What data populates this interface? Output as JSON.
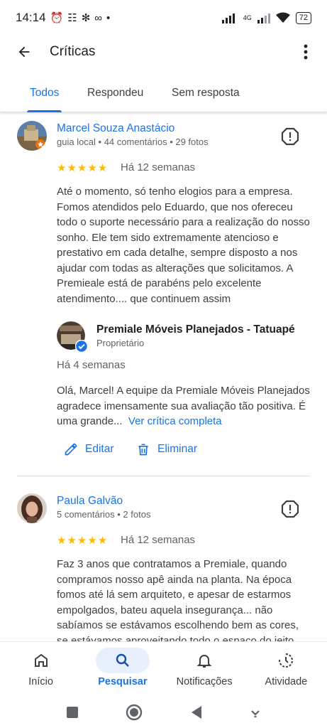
{
  "status_bar": {
    "time": "14:14",
    "network": "4G",
    "battery": "72"
  },
  "header": {
    "title": "Críticas"
  },
  "tabs": [
    {
      "label": "Todos",
      "active": true
    },
    {
      "label": "Respondeu",
      "active": false
    },
    {
      "label": "Sem resposta",
      "active": false
    }
  ],
  "reviews": [
    {
      "name": "Marcel Souza Anastácio",
      "meta": "guia local • 44 comentários • 29 fotos",
      "stars": "★★★★★",
      "rating": 5,
      "date": "Há 12 semanas",
      "text": "Até o momento, só tenho elogios para a empresa. Fomos atendidos pelo Eduardo, que nos ofereceu todo o suporte necessário para a realização do nosso sonho. Ele tem sido extremamente atencioso e prestativo em cada detalhe, sempre disposto a nos ajudar com todas as alterações que solicitamos. A Premieale está de parabéns pelo excelente atendimento.... que continuem assim",
      "reply": {
        "owner_name": "Premiale Móveis Planejados - Tatuapé",
        "owner_role": "Proprietário",
        "date": "Há 4 semanas",
        "text": "Olá, Marcel! A equipe da Premiale Móveis Planejados agradece imensamente sua avaliação tão positiva. É uma grande...",
        "read_more": "Ver crítica completa"
      },
      "actions": {
        "edit": "Editar",
        "delete": "Eliminar"
      }
    },
    {
      "name": "Paula Galvão",
      "meta": "5 comentários • 2 fotos",
      "stars": "★★★★★",
      "rating": 5,
      "date": "Há 12 semanas",
      "text": "Faz 3 anos que contratamos a Premiale, quando compramos nosso apê ainda na planta. Na época fomos até lá sem arquiteto, e apesar de estarmos empolgados, bateu aquela insegurança... não sabíamos se estávamos escolhendo bem as cores, se estávamos aproveitando todo o espaço do jeito"
    }
  ],
  "bottom_nav": [
    {
      "label": "Início",
      "icon": "home-icon",
      "active": false
    },
    {
      "label": "Pesquisar",
      "icon": "search-icon",
      "active": true
    },
    {
      "label": "Notificações",
      "icon": "bell-icon",
      "active": false
    },
    {
      "label": "Atividade",
      "icon": "activity-icon",
      "active": false
    }
  ],
  "colors": {
    "accent": "#1a73e8",
    "star": "#fbbc04",
    "text": "#3c4043",
    "muted": "#5f6368"
  }
}
